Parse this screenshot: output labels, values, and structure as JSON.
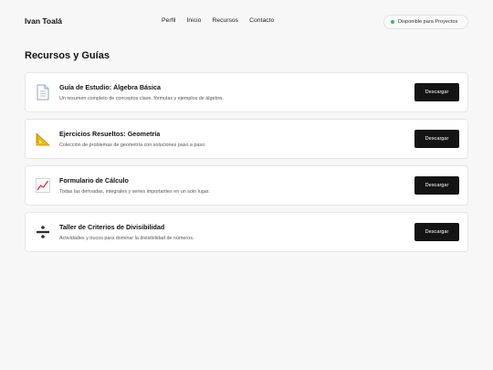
{
  "header": {
    "brand": "Ivan Toalá",
    "nav": [
      "Perfil",
      "Inicio",
      "Recursos",
      "Contacto"
    ],
    "status": "Disponible para Proyectos"
  },
  "section_title": "Recursos y Guías",
  "resources": [
    {
      "icon": "document-icon",
      "title": "Guía de Estudio: Álgebra Básica",
      "description": "Un resumen completo de conceptos clave, fórmulas y ejemplos de álgebra.",
      "button": "Descargar"
    },
    {
      "icon": "triangle-ruler-icon",
      "title": "Ejercicios Resueltos: Geometría",
      "description": "Colección de problemas de geometría con soluciones paso a paso.",
      "button": "Descargar"
    },
    {
      "icon": "chart-increasing-icon",
      "title": "Formulario de Cálculo",
      "description": "Todas las derivadas, integrales y series importantes en un solo lugar.",
      "button": "Descargar"
    },
    {
      "icon": "division-sign-icon",
      "title": "Taller de Criterios de Divisibilidad",
      "description": "Actividades y trucos para dominar la divisibilidad de números.",
      "button": "Descargar"
    }
  ],
  "colors": {
    "background": "#f7f7f7",
    "card": "#ffffff",
    "button": "#141414",
    "status_dot": "#2fbf5a"
  }
}
